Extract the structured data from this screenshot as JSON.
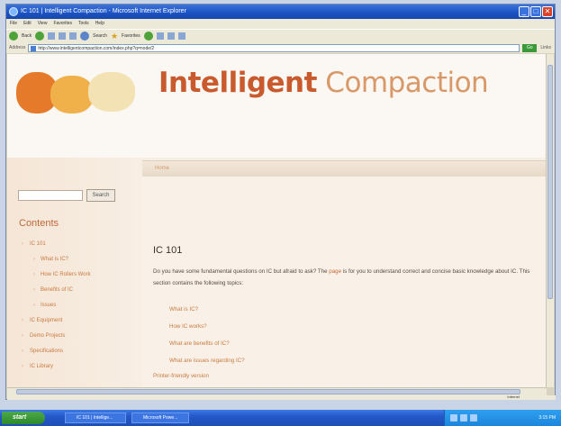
{
  "window": {
    "title": "IC 101 | Intelligent Compaction - Microsoft Internet Explorer",
    "controls": [
      "_",
      "□",
      "✕"
    ]
  },
  "menu": [
    "File",
    "Edit",
    "View",
    "Favorites",
    "Tools",
    "Help"
  ],
  "toolbar": {
    "back": "Back",
    "search": "Search",
    "favorites": "Favorites"
  },
  "address": {
    "label": "Address",
    "url": "http://www.intelligentcompaction.com/index.php?q=node/2",
    "go": "Go",
    "links": "Links"
  },
  "site": {
    "title_part1": "Intelligent",
    "title_part2": "Compaction",
    "breadcrumb": "Home"
  },
  "sidebar": {
    "search_button": "Search",
    "contents_heading": "Contents",
    "items": [
      {
        "label": "IC 101",
        "level": 0
      },
      {
        "label": "What is IC?",
        "level": 1
      },
      {
        "label": "How IC Rollers Work",
        "level": 1
      },
      {
        "label": "Benefits of IC",
        "level": 1
      },
      {
        "label": "Issues",
        "level": 1
      },
      {
        "label": "IC Equipment",
        "level": 0
      },
      {
        "label": "Demo Projects",
        "level": 0
      },
      {
        "label": "Specifications",
        "level": 0
      },
      {
        "label": "IC Library",
        "level": 0
      }
    ]
  },
  "main": {
    "title": "IC 101",
    "intro_before": "Do you have some fundamental questions on IC but afraid to ask? The ",
    "intro_link": "page",
    "intro_after": " is for you to understand correct and concise basic knowledge about IC. This section contains the following topics:",
    "topics": [
      "What is IC?",
      "How IC works?",
      "What are benefits of IC?",
      "What are issues regarding IC?"
    ],
    "printer_link": "Printer-friendly version"
  },
  "status": {
    "zone": "Internet"
  },
  "taskbar": {
    "start": "start",
    "tasks": [
      "IC 101 | Intellige...",
      "Microsoft Powe..."
    ],
    "clock": "3:15 PM"
  }
}
